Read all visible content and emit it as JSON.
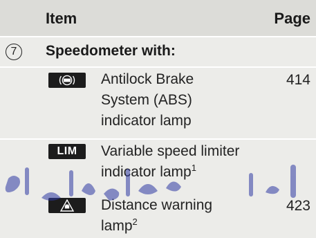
{
  "header": {
    "item": "Item",
    "page": "Page"
  },
  "section": {
    "number": "7",
    "title": "Speedometer with:",
    "rows": [
      {
        "icon": "abs-icon",
        "desc_lines": [
          "Antilock Brake",
          "System (ABS)",
          "indicator lamp"
        ],
        "sup": "",
        "page": "414"
      },
      {
        "icon": "lim-badge",
        "icon_text": "LIM",
        "desc_lines": [
          "Variable speed limiter",
          "indicator lamp"
        ],
        "sup": "1",
        "page": ""
      },
      {
        "icon": "distance-warning-icon",
        "desc_lines": [
          "Distance warning",
          "lamp"
        ],
        "sup": "2",
        "page": "423"
      }
    ]
  },
  "watermark": {
    "text": "ادا واه وورد"
  }
}
